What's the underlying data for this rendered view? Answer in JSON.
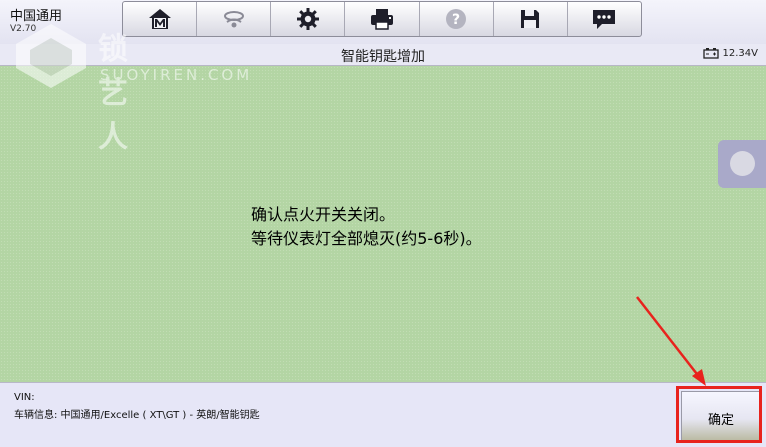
{
  "app": {
    "title": "中国通用",
    "version": "V2.70"
  },
  "toolbar": {
    "buttons": [
      {
        "icon": "home-m-icon"
      },
      {
        "icon": "vehicle-link-icon"
      },
      {
        "icon": "gear-icon"
      },
      {
        "icon": "printer-icon"
      },
      {
        "icon": "help-icon"
      },
      {
        "icon": "save-icon"
      },
      {
        "icon": "message-icon"
      }
    ]
  },
  "header": {
    "title": "智能钥匙增加",
    "battery_voltage": "12.34V"
  },
  "message": {
    "line1": "确认点火开关关闭。",
    "line2": "等待仪表灯全部熄灭(约5-6秒)。"
  },
  "watermark": {
    "text": "锁艺人",
    "subtext": "SUOYIREN.COM"
  },
  "footer": {
    "vin_label": "VIN:",
    "vehicle_info": "车辆信息: 中国通用/Excelle ( XT\\GT ) - 英朗/智能钥匙"
  },
  "actions": {
    "confirm_label": "确定"
  },
  "colors": {
    "main_bg": "#b3d5a4",
    "chrome_bg": "#e8e8f8",
    "highlight": "#e8231d"
  }
}
